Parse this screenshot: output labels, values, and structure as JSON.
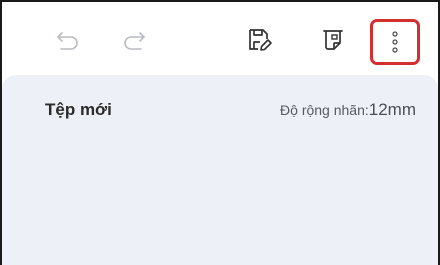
{
  "toolbar": {
    "undo_icon": "undo-icon",
    "redo_icon": "redo-icon",
    "save_icon": "save-edit-icon",
    "label_icon": "label-print-icon",
    "more_icon": "more-vertical-icon",
    "highlight_color": "#d32f2f"
  },
  "document": {
    "title": "Tệp mới",
    "width_label": "Độ rộng nhãn:",
    "width_value": "12mm",
    "background_color": "#edf1f7"
  }
}
